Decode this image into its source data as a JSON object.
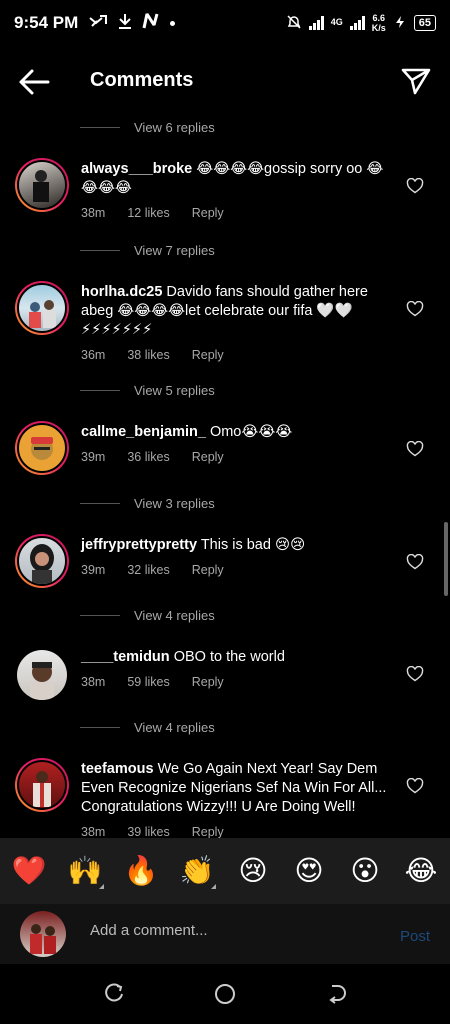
{
  "status": {
    "time": "9:54 PM",
    "network_type": "4G",
    "speed": "6.6",
    "speed_unit": "K/s",
    "battery": "65"
  },
  "header": {
    "title": "Comments",
    "back_icon": "arrow-left-icon",
    "send_icon": "paper-plane-icon"
  },
  "replies_label_prefix": "View",
  "reply_label": "Reply",
  "comments": [
    {
      "replies_above": "View 6 replies"
    },
    {
      "username": "always___broke",
      "text": "😂😂😂😂gossip sorry oo 😂😂😂😂",
      "time": "38m",
      "likes": "12 likes",
      "replies_below": "View 7 replies"
    },
    {
      "username": "horlha.dc25",
      "text": "Davido fans should gather here abeg 😂😂😂😂let celebrate our fifa 🤍🤍⚡⚡⚡⚡⚡⚡⚡",
      "time": "36m",
      "likes": "38 likes",
      "replies_below": "View 5 replies"
    },
    {
      "username": "callme_benjamin_",
      "text": "Omo😭😭😭",
      "time": "39m",
      "likes": "36 likes",
      "replies_below": "View 3 replies"
    },
    {
      "username": "jeffryprettypretty",
      "text": "This is bad 😢😢",
      "time": "39m",
      "likes": "32 likes",
      "replies_below": "View 4 replies"
    },
    {
      "username": "____temidun",
      "text": "OBO to the world",
      "time": "38m",
      "likes": "59 likes",
      "replies_below": "View 4 replies"
    },
    {
      "username": "teefamous",
      "text": "We Go Again Next Year! Say Dem Even Recognize Nigerians Sef Na Win For All... Congratulations Wizzy!!! U Are Doing Well!",
      "time": "38m",
      "likes": "39 likes"
    }
  ],
  "emoji_bar": [
    "❤️",
    "🙌",
    "🔥",
    "👏",
    "😢",
    "😍",
    "😮",
    "😂"
  ],
  "composer": {
    "placeholder": "Add a comment...",
    "post_label": "Post"
  }
}
